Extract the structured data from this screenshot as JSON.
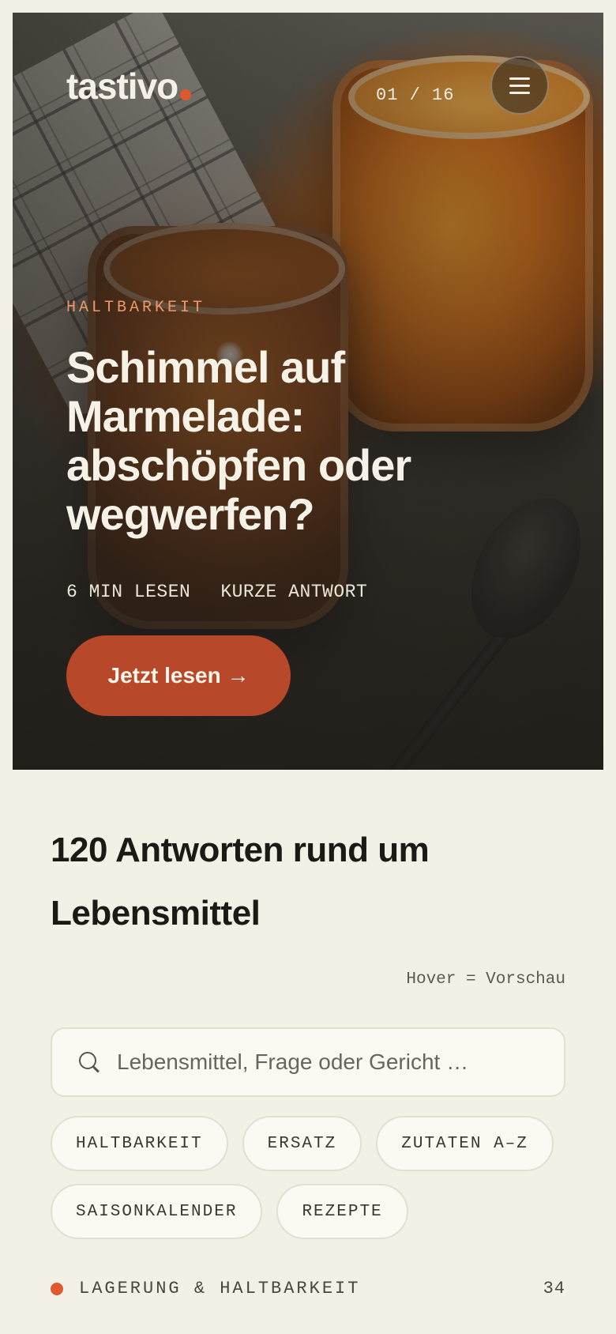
{
  "brand": {
    "name": "tastivo",
    "accent": "#e0582d"
  },
  "hero": {
    "counter": "01 / 16",
    "category": "HALTBARKEIT",
    "title": "Schimmel auf Marmelade: abschöpfen oder wegwerfen?",
    "meta": [
      "6 MIN LESEN",
      "KURZE ANTWORT"
    ],
    "cta_label": "Jetzt lesen →",
    "cta_color": "#b7482a"
  },
  "section": {
    "title": "120 Antworten rund um Lebensmittel",
    "hint": "Hover = Vorschau"
  },
  "search": {
    "placeholder": "Lebensmittel, Frage oder Gericht …",
    "icon": "search-icon"
  },
  "chips": [
    "HALTBARKEIT",
    "ERSATZ",
    "ZUTATEN A–Z",
    "SAISONKALENDER",
    "REZEPTE"
  ],
  "categories": [
    {
      "label": "LAGERUNG & HALTBARKEIT",
      "count": "34"
    }
  ]
}
